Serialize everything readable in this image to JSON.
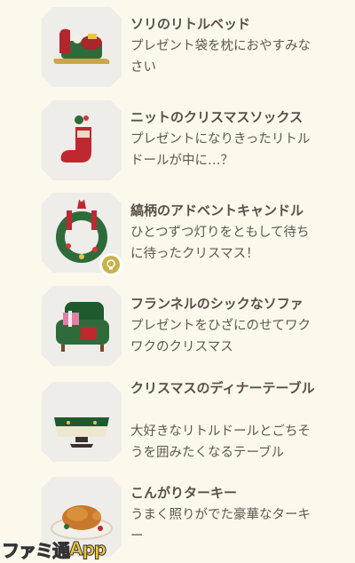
{
  "items": [
    {
      "title": "ソリのリトルベッド",
      "desc": "プレゼント袋を枕におやすみなさい",
      "icon": "sleigh-bed-icon"
    },
    {
      "title": "ニットのクリスマスソックス",
      "desc": "プレゼントになりきったリトルドールが中に…？",
      "icon": "christmas-sock-icon"
    },
    {
      "title": "縞柄のアドベントキャンドル",
      "desc": "ひとつずつ灯りをともして待ちに待ったクリスマス！",
      "icon": "advent-wreath-icon",
      "badge": "lightbulb-badge-icon"
    },
    {
      "title": "フランネルのシックなソファ",
      "desc": "プレゼントをひざにのせてワクワクのクリスマス",
      "icon": "green-sofa-icon"
    },
    {
      "title": "クリスマスのディナーテーブル",
      "desc": "大好きなリトルドールとごちそうを囲みたくなるテーブル",
      "icon": "dinner-table-icon"
    },
    {
      "title": "こんがりターキー",
      "desc": "うまく照りがでた豪華なターキー",
      "icon": "roast-turkey-icon"
    }
  ],
  "watermark": {
    "part1": "ファミ通",
    "part2": "App"
  }
}
